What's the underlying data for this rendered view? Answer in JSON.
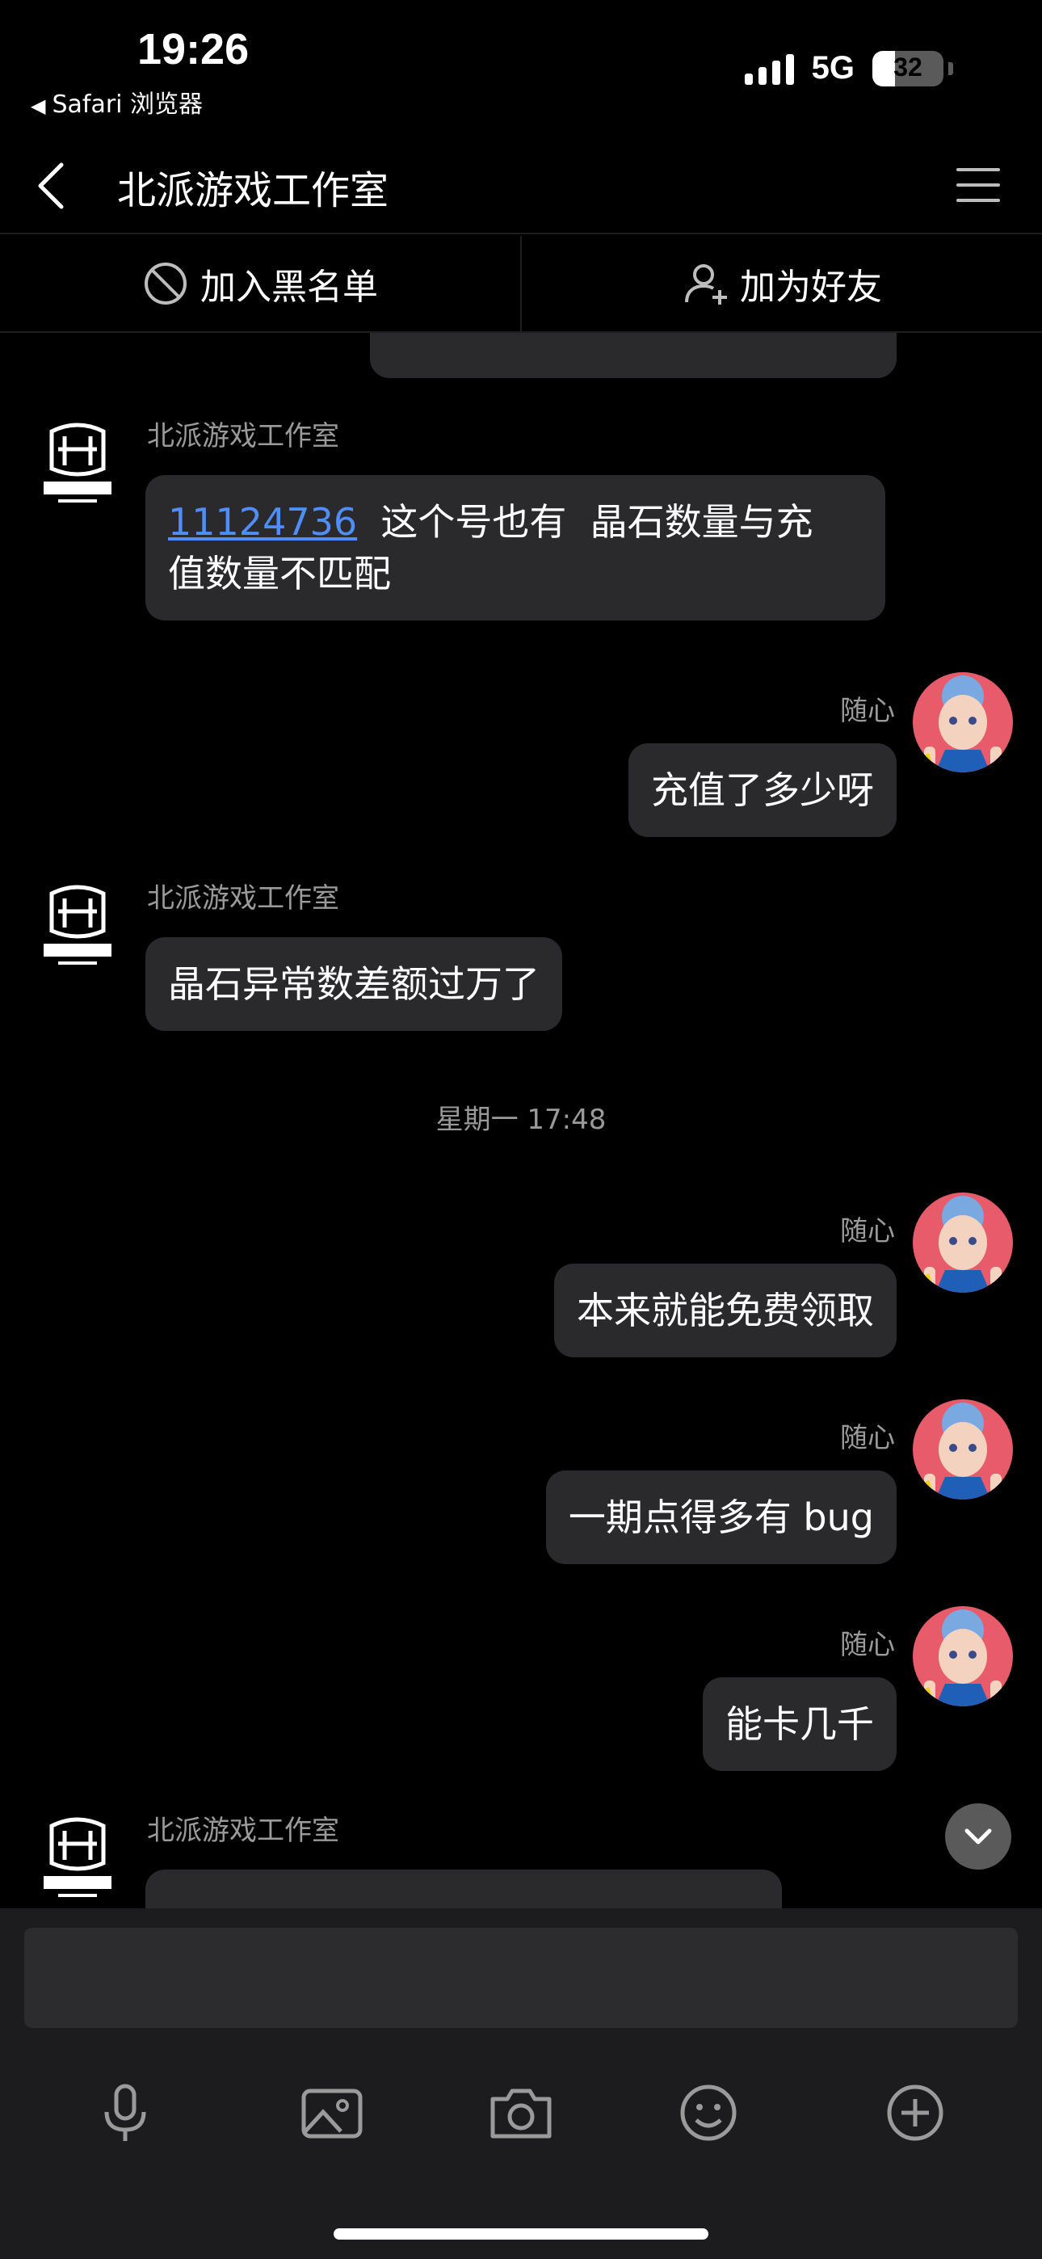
{
  "status_bar": {
    "time": "19:26",
    "back_app": "Safari 浏览器",
    "network": "5G",
    "battery": "32",
    "battery_level": 0.32
  },
  "nav": {
    "title": "北派游戏工作室"
  },
  "actions": {
    "blacklist": "加入黑名单",
    "add_friend": "加为好友"
  },
  "messages": [
    {
      "side": "left",
      "sender": "北派游戏工作室",
      "link": "11124736",
      "text_line1_rest": "  这个号也有  晶石数量与充",
      "text_line2": "值数量不匹配"
    },
    {
      "side": "right",
      "sender": "随心",
      "text": "充值了多少呀"
    },
    {
      "side": "left",
      "sender": "北派游戏工作室",
      "text": "晶石异常数差额过万了"
    },
    {
      "type": "timestamp",
      "text": "星期一 17:48"
    },
    {
      "side": "right",
      "sender": "随心",
      "text": "本来就能免费领取"
    },
    {
      "side": "right",
      "sender": "随心",
      "text": "一期点得多有 bug"
    },
    {
      "side": "right",
      "sender": "随心",
      "text": "能卡几千"
    },
    {
      "side": "left",
      "sender": "北派游戏工作室"
    }
  ],
  "colors": {
    "background": "#000000",
    "bubble": "#2a2a2c",
    "link": "#4f8ef7",
    "meta_text": "#9a9a9a",
    "composer": "#1c1c1e"
  },
  "icons": {
    "nav_back": "chevron-left-icon",
    "nav_menu": "menu-icon",
    "blacklist": "block-icon",
    "add_friend": "add-user-icon",
    "scroll_down": "chevron-down-icon",
    "voice": "microphone-icon",
    "image": "image-icon",
    "camera": "camera-icon",
    "emoji": "emoji-icon",
    "more": "plus-circle-icon"
  }
}
